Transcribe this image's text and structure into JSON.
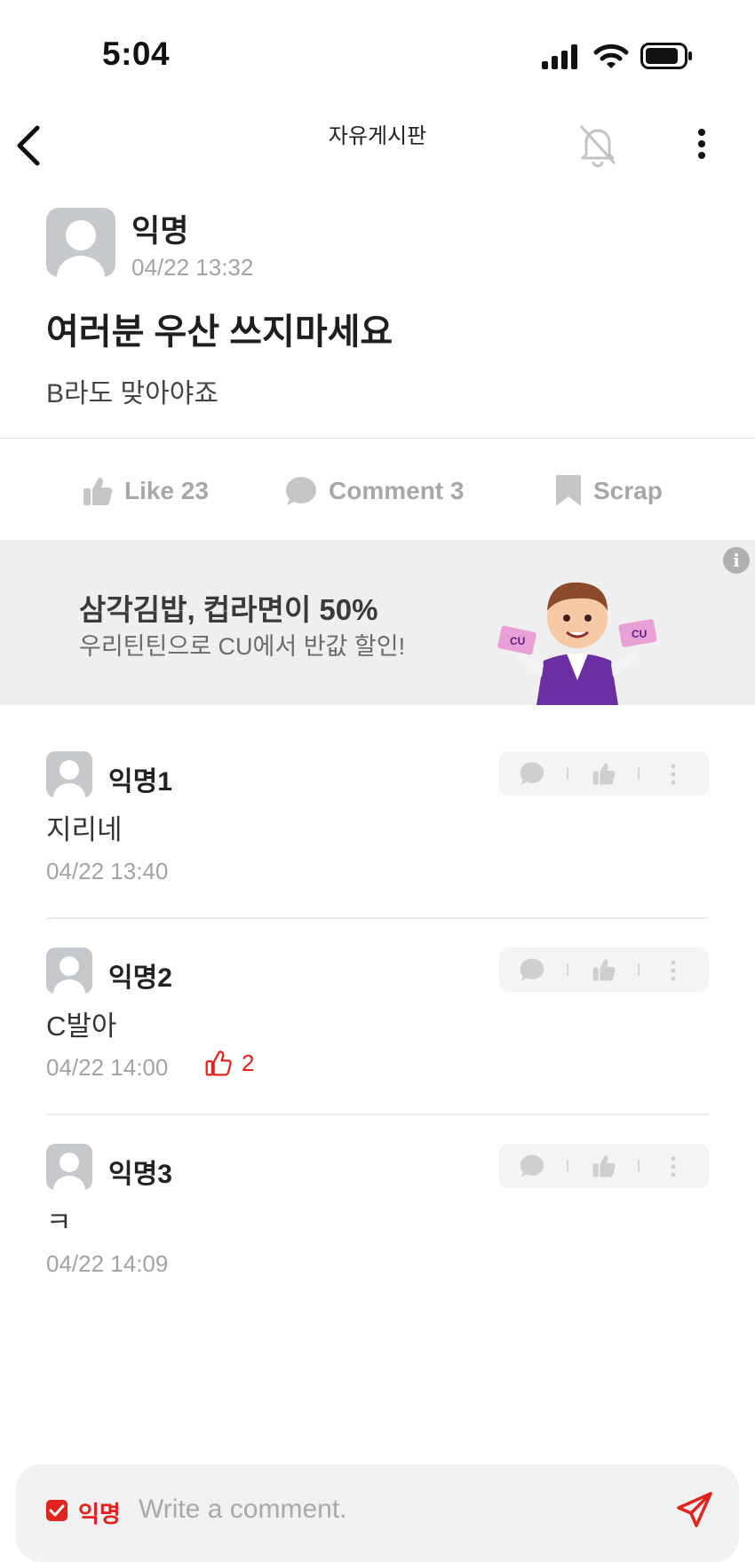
{
  "status_bar": {
    "time": "5:04"
  },
  "nav": {
    "board_title": "자유게시판"
  },
  "post": {
    "author": "익명",
    "date": "04/22 13:32",
    "title": "여러분 우산 쓰지마세요",
    "body": "B라도 맞아야죠"
  },
  "actions": {
    "like_label": "Like 23",
    "comment_label": "Comment 3",
    "scrap_label": "Scrap"
  },
  "ad": {
    "title": "삼각김밥, 컵라면이 50%",
    "subtitle": "우리틴틴으로 CU에서 반값 할인!",
    "info_glyph": "i",
    "card_brand": "CU"
  },
  "comments": [
    {
      "author": "익명1",
      "body": "지리네",
      "date": "04/22 13:40",
      "likes": ""
    },
    {
      "author": "익명2",
      "body": "C발아",
      "date": "04/22 14:00",
      "likes": "2"
    },
    {
      "author": "익명3",
      "body": "ㅋ",
      "date": "04/22 14:09",
      "likes": ""
    }
  ],
  "composer": {
    "anonymous_label": "익명",
    "anonymous_checked": true,
    "placeholder": "Write a comment."
  },
  "colors": {
    "accent": "#e0231c",
    "muted_text": "#a3a3a3",
    "banner_bg": "#efefef"
  },
  "icons": {
    "back": "chevron-left-icon",
    "notifications": "bell-off-icon",
    "more": "more-vertical-icon",
    "like": "thumbs-up-icon",
    "comment": "chat-bubble-icon",
    "scrap": "bookmark-icon",
    "send": "paper-plane-icon"
  }
}
